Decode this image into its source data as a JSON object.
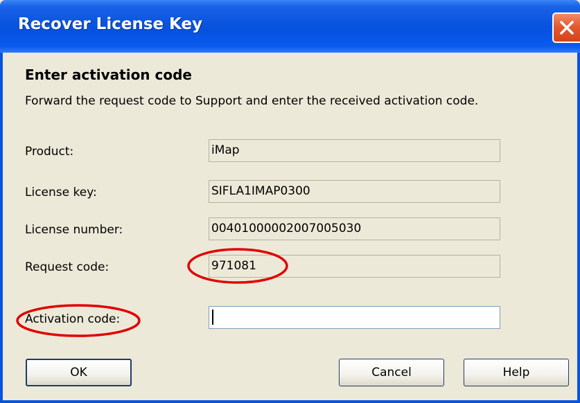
{
  "window": {
    "title": "Recover License Key"
  },
  "section": {
    "heading": "Enter activation code",
    "description": "Forward the request code to Support and enter the received activation code."
  },
  "fields": {
    "product": {
      "label": "Product:",
      "value": "iMap"
    },
    "license_key": {
      "label": "License key:",
      "value": "SIFLA1IMAP0300"
    },
    "license_number": {
      "label": "License number:",
      "value": "00401000002007005030"
    },
    "request_code": {
      "label": "Request code:",
      "value": "971081"
    },
    "activation_code": {
      "label": "Activation code:",
      "value": ""
    }
  },
  "buttons": {
    "ok": "OK",
    "cancel": "Cancel",
    "help": "Help"
  },
  "colors": {
    "annotation": "#E00000",
    "titlebar": "#0A54DD",
    "dialog_bg": "#ECE9D8"
  }
}
